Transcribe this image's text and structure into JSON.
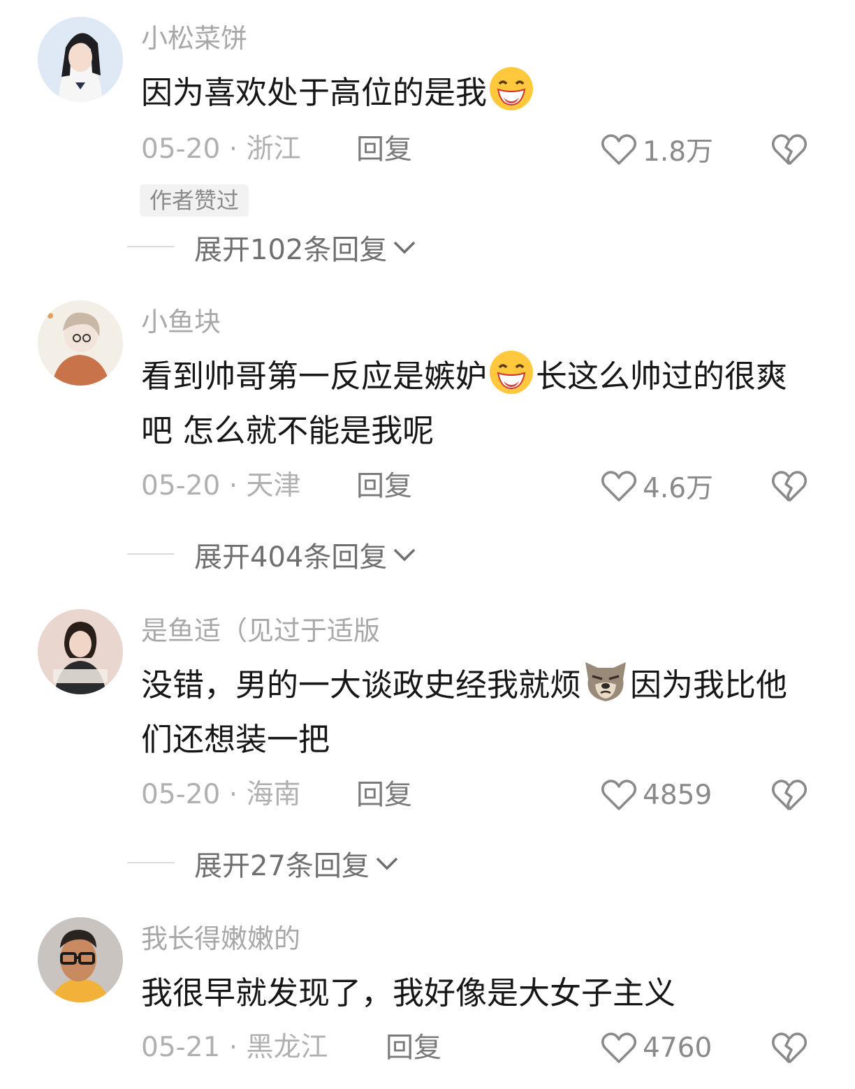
{
  "reply_label": "回复",
  "badge_author_liked": "作者赞过",
  "comments": [
    {
      "username": "小松菜饼",
      "text_parts": [
        "因为喜欢处于高位的是我",
        ""
      ],
      "emoji": "grin-emoji",
      "date": "05-20",
      "region": "浙江",
      "likes": "1.8万",
      "expand": "展开102条回复"
    },
    {
      "username": "小鱼块",
      "text_parts": [
        "看到帅哥第一反应是嫉妒",
        "长这么帅过的很爽吧 怎么就不能是我呢"
      ],
      "emoji": "grin-emoji",
      "date": "05-20",
      "region": "天津",
      "likes": "4.6万",
      "expand": "展开404条回复"
    },
    {
      "username": "是鱼适（见过于适版",
      "text_parts": [
        "没错，男的一大谈政史经我就烦",
        "因为我比他们还想装一把"
      ],
      "emoji": "dog-emoji",
      "date": "05-20",
      "region": "海南",
      "likes": "4859",
      "expand": "展开27条回复"
    },
    {
      "username": "我长得嫩嫩的",
      "text_parts": [
        "我很早就发现了，我好像是大女子主义",
        ""
      ],
      "emoji": "",
      "date": "05-21",
      "region": "黑龙江",
      "likes": "4760",
      "expand": ""
    }
  ],
  "colors": {
    "text": "#161616",
    "muted": "#b0b0b0",
    "reply": "#7a7a7a",
    "badge_bg": "#f2f2f2"
  }
}
